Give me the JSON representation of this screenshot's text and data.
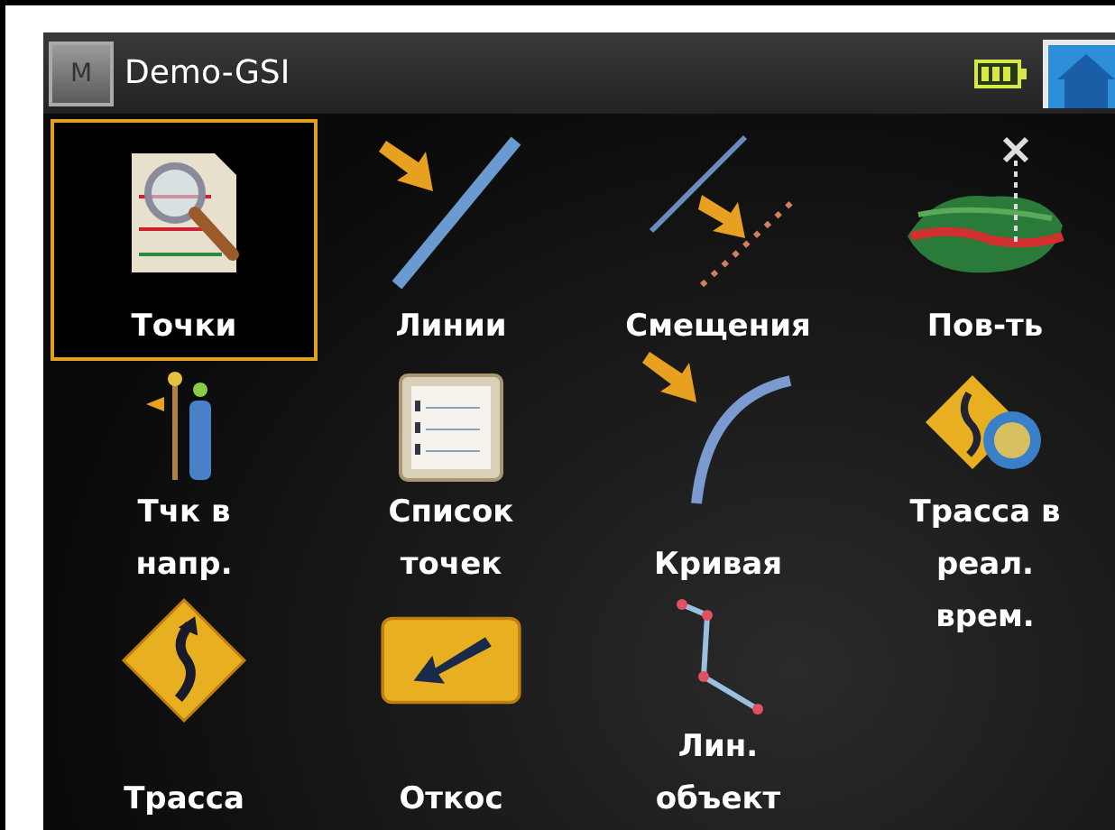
{
  "window": {
    "title": "Demo-GSI",
    "app_badge": "M"
  },
  "status": {
    "battery": true
  },
  "items": [
    {
      "kind": "points",
      "label": "Точки",
      "selected": true
    },
    {
      "kind": "lines",
      "label": "Линии",
      "selected": false
    },
    {
      "kind": "offsets",
      "label": "Смещения",
      "selected": false
    },
    {
      "kind": "surface",
      "label": "Пов-ть",
      "selected": false
    },
    {
      "kind": "direction",
      "label": "Тчк в\nнапр.",
      "selected": false
    },
    {
      "kind": "list",
      "label": "Список\nточек",
      "selected": false
    },
    {
      "kind": "curve",
      "label": "Кривая",
      "selected": false
    },
    {
      "kind": "realtime",
      "label": "Трасса в\nреал.\nврем.",
      "selected": false
    },
    {
      "kind": "road",
      "label": "Трасса",
      "selected": false
    },
    {
      "kind": "slope",
      "label": "Откос",
      "selected": false
    },
    {
      "kind": "linework",
      "label": "Лин.\nобъект",
      "selected": false
    }
  ]
}
